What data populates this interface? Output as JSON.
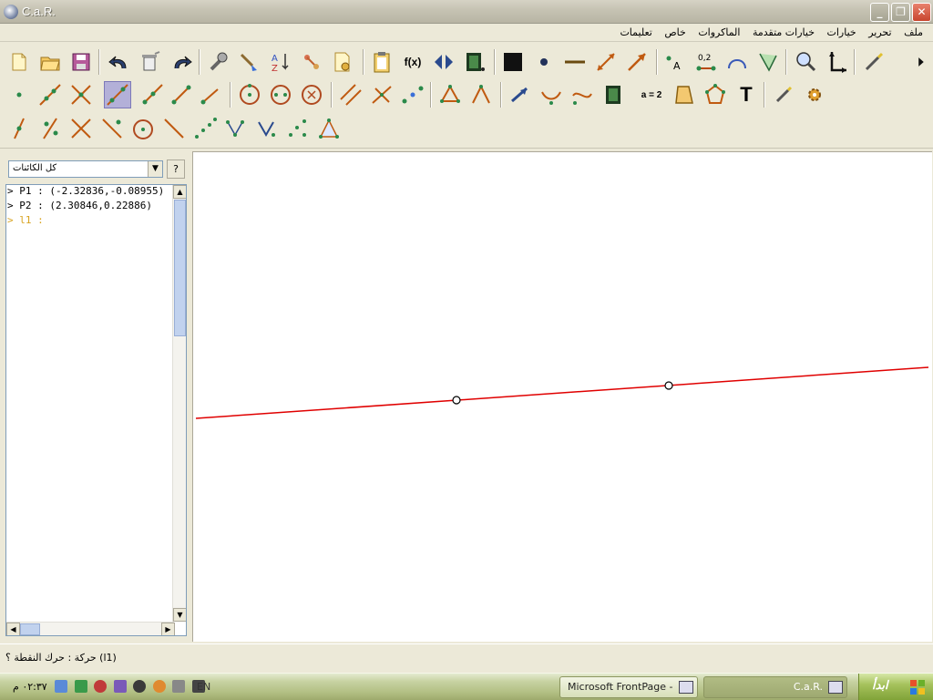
{
  "window": {
    "title": "C.a.R.",
    "buttons": {
      "minimize": "_",
      "maximize": "❐",
      "close": "✕"
    }
  },
  "menu": {
    "items": [
      "ملف",
      "تحرير",
      "خيارات",
      "خيارات متقدمة",
      "الماكروات",
      "خاص",
      "تعليمات"
    ]
  },
  "toolbar": {
    "fx_label": "f(x)",
    "coord_label": "0,2",
    "point_label": "A",
    "eq_label": "a = 2",
    "text_label": "T"
  },
  "objects_panel": {
    "filter_value": "كل الكائنات",
    "help_label": "?",
    "rows": [
      {
        "text": "> P1 : (-2.32836,-0.08955)",
        "state": "normal"
      },
      {
        "text": "> P2 : (2.30846,0.22886)",
        "state": "normal"
      },
      {
        "text": "> l1 :",
        "state": "pending"
      }
    ]
  },
  "canvas": {
    "line_color": "#e00000",
    "point_fill": "#ffffff"
  },
  "status": {
    "message": "(l1) حركة : حرك النقطة ؟"
  },
  "taskbar": {
    "clock": "٠٢:٣٧ م",
    "language": "EN",
    "tasks": [
      {
        "label": "Microsoft FrontPage - ...",
        "id": "frontpage"
      },
      {
        "label": "C.a.R.",
        "id": "car"
      }
    ],
    "start_label": "ابدأ"
  }
}
